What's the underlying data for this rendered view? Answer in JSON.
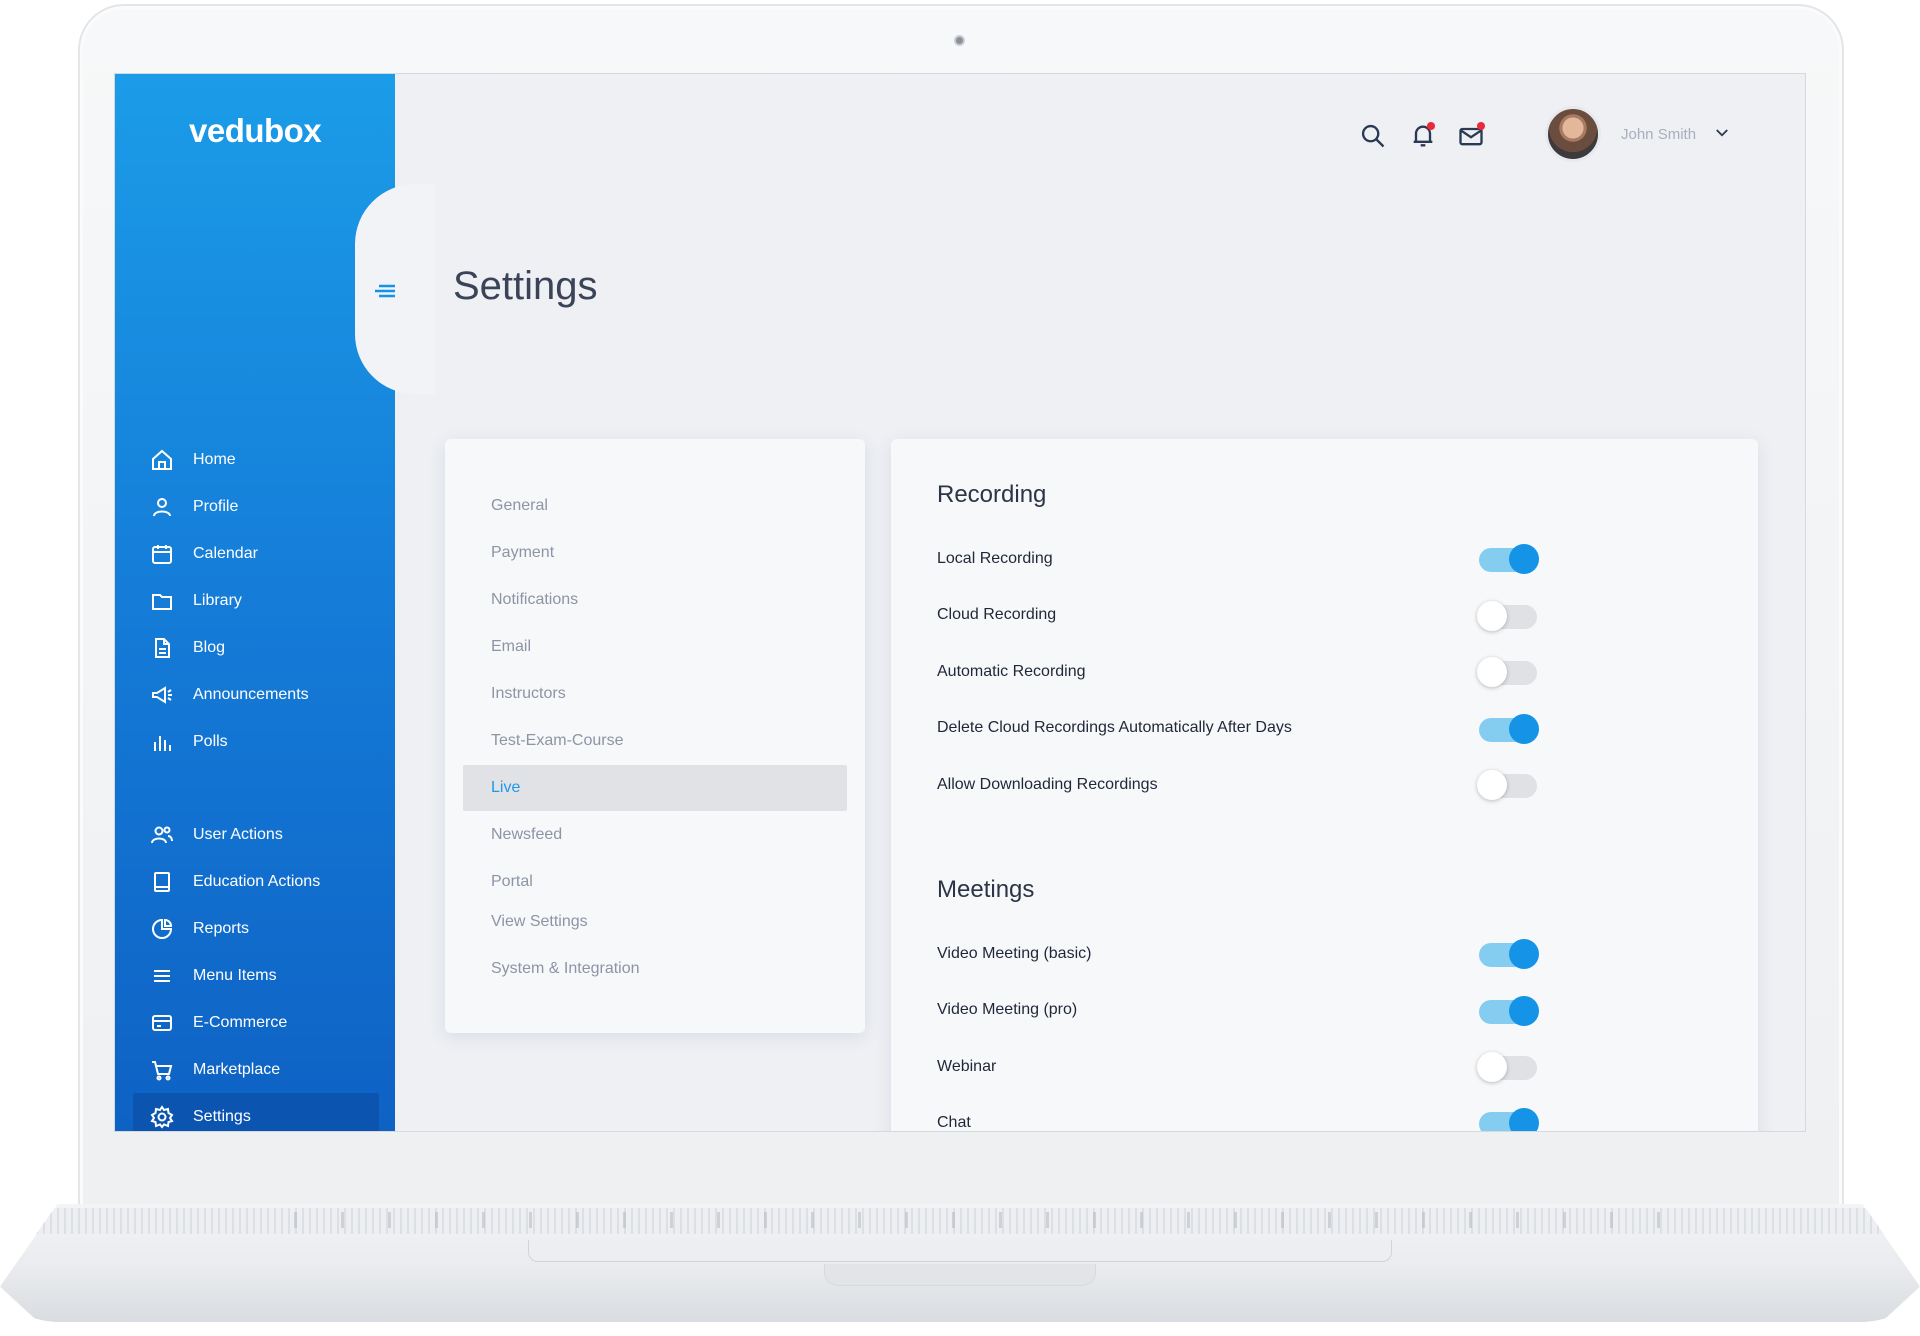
{
  "brand": {
    "logo": "vedubox"
  },
  "sidebar": {
    "items": [
      {
        "label": "Home",
        "icon": "home-icon"
      },
      {
        "label": "Profile",
        "icon": "user-icon"
      },
      {
        "label": "Calendar",
        "icon": "calendar-icon"
      },
      {
        "label": "Library",
        "icon": "folder-icon"
      },
      {
        "label": "Blog",
        "icon": "document-icon"
      },
      {
        "label": "Announcements",
        "icon": "megaphone-icon"
      },
      {
        "label": "Polls",
        "icon": "bar-chart-icon"
      },
      {
        "label": "User Actions",
        "icon": "users-icon"
      },
      {
        "label": "Education Actions",
        "icon": "book-icon"
      },
      {
        "label": "Reports",
        "icon": "pie-chart-icon"
      },
      {
        "label": "Menu Items",
        "icon": "list-icon"
      },
      {
        "label": "E-Commerce",
        "icon": "credit-card-icon"
      },
      {
        "label": "Marketplace",
        "icon": "cart-icon"
      },
      {
        "label": "Settings",
        "icon": "gear-icon",
        "active": true
      }
    ]
  },
  "header": {
    "user_name": "John Smith",
    "icons": [
      "search-icon",
      "bell-icon",
      "mail-icon"
    ],
    "notification_dot_color": "#ea2a3a"
  },
  "page": {
    "title": "Settings"
  },
  "settings_menu": {
    "items": [
      "General",
      "Payment",
      "Notifications",
      "Email",
      "Instructors",
      "Test-Exam-Course",
      "Live",
      "Newsfeed",
      "Portal",
      "View Settings",
      "System & Integration"
    ],
    "active": "Live"
  },
  "recording": {
    "title": "Recording",
    "rows": [
      {
        "label": "Local Recording",
        "on": true
      },
      {
        "label": "Cloud Recording",
        "on": false
      },
      {
        "label": "Automatic Recording",
        "on": false
      },
      {
        "label": "Delete Cloud Recordings Automatically After Days",
        "on": true
      },
      {
        "label": "Allow Downloading Recordings",
        "on": false
      }
    ]
  },
  "meetings": {
    "title": "Meetings",
    "rows": [
      {
        "label": "Video Meeting (basic)",
        "on": true
      },
      {
        "label": "Video Meeting (pro)",
        "on": true
      },
      {
        "label": "Webinar",
        "on": false
      },
      {
        "label": "Chat",
        "on": true
      }
    ]
  },
  "colors": {
    "accent": "#1593e7",
    "sidebar": "#1479d6",
    "toggle_on_track": "#84cdf1"
  }
}
